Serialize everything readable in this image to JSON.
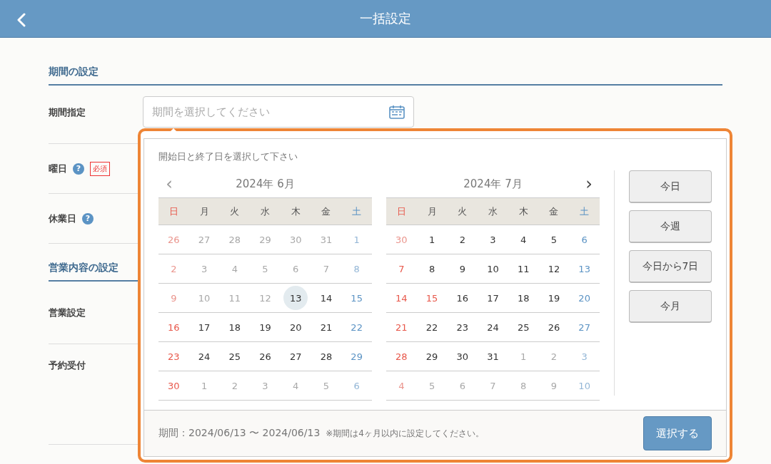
{
  "header": {
    "title": "一括設定"
  },
  "sections": [
    {
      "title": "期間の設定",
      "rows": [
        {
          "label": "期間指定",
          "kind": "field",
          "placeholder": "期間を選択してください"
        },
        {
          "label": "曜日",
          "kind": "help",
          "help": "?",
          "required": "必須"
        },
        {
          "label": "休業日",
          "kind": "help",
          "help": "?"
        }
      ]
    },
    {
      "title": "営業内容の設定",
      "rows": [
        {
          "label": "営業設定",
          "kind": "plain"
        },
        {
          "label": "予約受付",
          "kind": "tall"
        }
      ]
    }
  ],
  "picker": {
    "instruction": "開始日と終了日を選択して下さい",
    "prev": "‹",
    "next": "›",
    "months": [
      {
        "title": "2024年 6月",
        "weekdays": [
          "日",
          "月",
          "火",
          "水",
          "木",
          "金",
          "土"
        ],
        "weeks": [
          [
            {
              "d": "26",
              "other": true,
              "kind": "sunday",
              "selected": false
            },
            {
              "d": "27",
              "other": true,
              "kind": "weekday",
              "selected": false
            },
            {
              "d": "28",
              "other": true,
              "kind": "weekday",
              "selected": false
            },
            {
              "d": "29",
              "other": true,
              "kind": "weekday",
              "selected": false
            },
            {
              "d": "30",
              "other": true,
              "kind": "weekday",
              "selected": false
            },
            {
              "d": "31",
              "other": true,
              "kind": "weekday",
              "selected": false
            },
            {
              "d": "1",
              "other": true,
              "kind": "saturday",
              "selected": false
            }
          ],
          [
            {
              "d": "2",
              "other": true,
              "kind": "sunday",
              "selected": false
            },
            {
              "d": "3",
              "other": true,
              "kind": "weekday",
              "selected": false
            },
            {
              "d": "4",
              "other": true,
              "kind": "weekday",
              "selected": false
            },
            {
              "d": "5",
              "other": true,
              "kind": "weekday",
              "selected": false
            },
            {
              "d": "6",
              "other": true,
              "kind": "weekday",
              "selected": false
            },
            {
              "d": "7",
              "other": true,
              "kind": "weekday",
              "selected": false
            },
            {
              "d": "8",
              "other": true,
              "kind": "saturday",
              "selected": false
            }
          ],
          [
            {
              "d": "9",
              "other": true,
              "kind": "sunday",
              "selected": false
            },
            {
              "d": "10",
              "other": true,
              "kind": "weekday",
              "selected": false
            },
            {
              "d": "11",
              "other": true,
              "kind": "weekday",
              "selected": false
            },
            {
              "d": "12",
              "other": true,
              "kind": "weekday",
              "selected": false
            },
            {
              "d": "13",
              "other": false,
              "kind": "weekday",
              "selected": true
            },
            {
              "d": "14",
              "other": false,
              "kind": "weekday",
              "selected": false
            },
            {
              "d": "15",
              "other": false,
              "kind": "saturday",
              "selected": false
            }
          ],
          [
            {
              "d": "16",
              "other": false,
              "kind": "sunday",
              "selected": false
            },
            {
              "d": "17",
              "other": false,
              "kind": "weekday",
              "selected": false
            },
            {
              "d": "18",
              "other": false,
              "kind": "weekday",
              "selected": false
            },
            {
              "d": "19",
              "other": false,
              "kind": "weekday",
              "selected": false
            },
            {
              "d": "20",
              "other": false,
              "kind": "weekday",
              "selected": false
            },
            {
              "d": "21",
              "other": false,
              "kind": "weekday",
              "selected": false
            },
            {
              "d": "22",
              "other": false,
              "kind": "saturday",
              "selected": false
            }
          ],
          [
            {
              "d": "23",
              "other": false,
              "kind": "sunday",
              "selected": false
            },
            {
              "d": "24",
              "other": false,
              "kind": "weekday",
              "selected": false
            },
            {
              "d": "25",
              "other": false,
              "kind": "weekday",
              "selected": false
            },
            {
              "d": "26",
              "other": false,
              "kind": "weekday",
              "selected": false
            },
            {
              "d": "27",
              "other": false,
              "kind": "weekday",
              "selected": false
            },
            {
              "d": "28",
              "other": false,
              "kind": "weekday",
              "selected": false
            },
            {
              "d": "29",
              "other": false,
              "kind": "saturday",
              "selected": false
            }
          ],
          [
            {
              "d": "30",
              "other": false,
              "kind": "sunday",
              "selected": false
            },
            {
              "d": "1",
              "other": true,
              "kind": "weekday",
              "selected": false
            },
            {
              "d": "2",
              "other": true,
              "kind": "weekday",
              "selected": false
            },
            {
              "d": "3",
              "other": true,
              "kind": "weekday",
              "selected": false
            },
            {
              "d": "4",
              "other": true,
              "kind": "weekday",
              "selected": false
            },
            {
              "d": "5",
              "other": true,
              "kind": "weekday",
              "selected": false
            },
            {
              "d": "6",
              "other": true,
              "kind": "saturday",
              "selected": false
            }
          ]
        ]
      },
      {
        "title": "2024年 7月",
        "weekdays": [
          "日",
          "月",
          "火",
          "水",
          "木",
          "金",
          "土"
        ],
        "weeks": [
          [
            {
              "d": "30",
              "other": true,
              "kind": "sunday",
              "selected": false
            },
            {
              "d": "1",
              "other": false,
              "kind": "weekday",
              "selected": false
            },
            {
              "d": "2",
              "other": false,
              "kind": "weekday",
              "selected": false
            },
            {
              "d": "3",
              "other": false,
              "kind": "weekday",
              "selected": false
            },
            {
              "d": "4",
              "other": false,
              "kind": "weekday",
              "selected": false
            },
            {
              "d": "5",
              "other": false,
              "kind": "weekday",
              "selected": false
            },
            {
              "d": "6",
              "other": false,
              "kind": "saturday",
              "selected": false
            }
          ],
          [
            {
              "d": "7",
              "other": false,
              "kind": "sunday",
              "selected": false
            },
            {
              "d": "8",
              "other": false,
              "kind": "weekday",
              "selected": false
            },
            {
              "d": "9",
              "other": false,
              "kind": "weekday",
              "selected": false
            },
            {
              "d": "10",
              "other": false,
              "kind": "weekday",
              "selected": false
            },
            {
              "d": "11",
              "other": false,
              "kind": "weekday",
              "selected": false
            },
            {
              "d": "12",
              "other": false,
              "kind": "weekday",
              "selected": false
            },
            {
              "d": "13",
              "other": false,
              "kind": "saturday",
              "selected": false
            }
          ],
          [
            {
              "d": "14",
              "other": false,
              "kind": "sunday",
              "selected": false
            },
            {
              "d": "15",
              "other": false,
              "kind": "holiday",
              "selected": false
            },
            {
              "d": "16",
              "other": false,
              "kind": "weekday",
              "selected": false
            },
            {
              "d": "17",
              "other": false,
              "kind": "weekday",
              "selected": false
            },
            {
              "d": "18",
              "other": false,
              "kind": "weekday",
              "selected": false
            },
            {
              "d": "19",
              "other": false,
              "kind": "weekday",
              "selected": false
            },
            {
              "d": "20",
              "other": false,
              "kind": "saturday",
              "selected": false
            }
          ],
          [
            {
              "d": "21",
              "other": false,
              "kind": "sunday",
              "selected": false
            },
            {
              "d": "22",
              "other": false,
              "kind": "weekday",
              "selected": false
            },
            {
              "d": "23",
              "other": false,
              "kind": "weekday",
              "selected": false
            },
            {
              "d": "24",
              "other": false,
              "kind": "weekday",
              "selected": false
            },
            {
              "d": "25",
              "other": false,
              "kind": "weekday",
              "selected": false
            },
            {
              "d": "26",
              "other": false,
              "kind": "weekday",
              "selected": false
            },
            {
              "d": "27",
              "other": false,
              "kind": "saturday",
              "selected": false
            }
          ],
          [
            {
              "d": "28",
              "other": false,
              "kind": "sunday",
              "selected": false
            },
            {
              "d": "29",
              "other": false,
              "kind": "weekday",
              "selected": false
            },
            {
              "d": "30",
              "other": false,
              "kind": "weekday",
              "selected": false
            },
            {
              "d": "31",
              "other": false,
              "kind": "weekday",
              "selected": false
            },
            {
              "d": "1",
              "other": true,
              "kind": "weekday",
              "selected": false
            },
            {
              "d": "2",
              "other": true,
              "kind": "weekday",
              "selected": false
            },
            {
              "d": "3",
              "other": true,
              "kind": "saturday",
              "selected": false
            }
          ],
          [
            {
              "d": "4",
              "other": true,
              "kind": "sunday",
              "selected": false
            },
            {
              "d": "5",
              "other": true,
              "kind": "weekday",
              "selected": false
            },
            {
              "d": "6",
              "other": true,
              "kind": "weekday",
              "selected": false
            },
            {
              "d": "7",
              "other": true,
              "kind": "weekday",
              "selected": false
            },
            {
              "d": "8",
              "other": true,
              "kind": "weekday",
              "selected": false
            },
            {
              "d": "9",
              "other": true,
              "kind": "weekday",
              "selected": false
            },
            {
              "d": "10",
              "other": true,
              "kind": "saturday",
              "selected": false
            }
          ]
        ]
      }
    ],
    "shortcuts": [
      "今日",
      "今週",
      "今日から7日",
      "今月"
    ],
    "period": "期間：2024/06/13 〜 2024/06/13",
    "note": "※期間は4ヶ月以内に設定してください。",
    "confirm": "選択する"
  }
}
